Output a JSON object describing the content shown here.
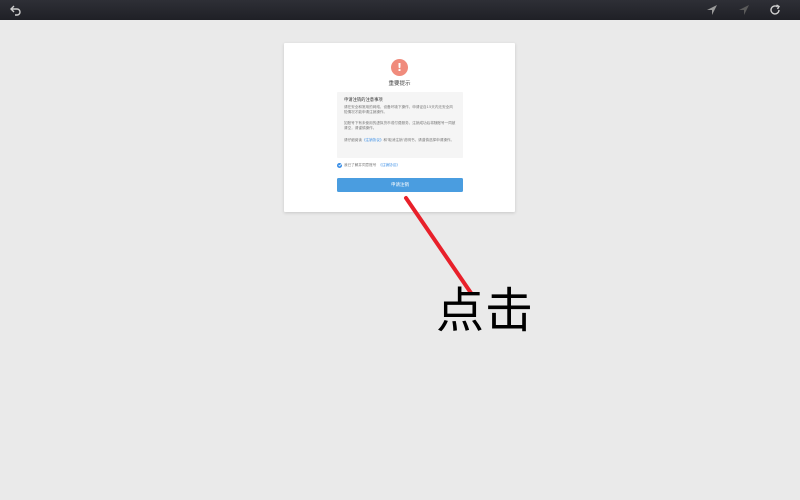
{
  "toolbar": {
    "back_icon": "undo-arrow-icon",
    "pin_icon": "pin-icon",
    "pin_disabled_icon": "pin-disabled-icon",
    "refresh_icon": "refresh-icon"
  },
  "dialog": {
    "warning_icon": "exclamation-icon",
    "warning_glyph": "!",
    "title": "重要提示",
    "notice": {
      "heading": "申请注销的注意事项",
      "paragraphs": [
        "请在安全和常用的网络、设备环境下操作，申请证自15天内无安全风险情况才能申请注销操作。",
        "如账号下有未使用的虚拟货币或付费服务，注销成功后将随账号一同被清空，请谨慎操作。"
      ],
      "p3_prefix": "请仔细阅读",
      "p3_link": "《注销协议》",
      "p3_suffix": "和‘取消注销’说明书，请谨慎选择申请操作。"
    },
    "agree_text": "我已了解并同意账号",
    "agree_link": "《注销协议》",
    "submit_label": "申请注销"
  },
  "annotation": {
    "text": "点击",
    "color": "#e8202a"
  }
}
